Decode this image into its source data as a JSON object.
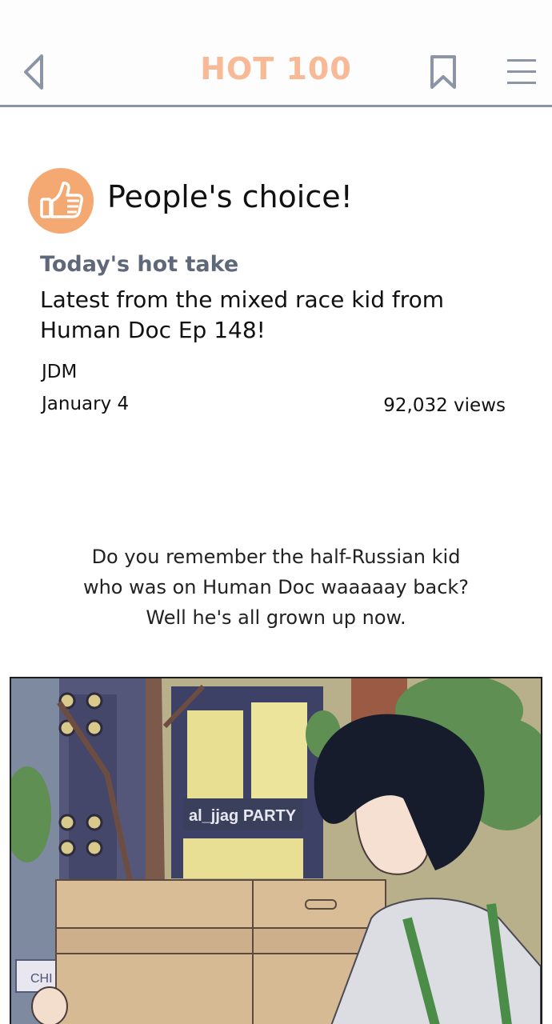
{
  "header": {
    "title": "HOT 100",
    "back_icon": "chevron-left-icon",
    "bookmark_icon": "bookmark-icon",
    "menu_icon": "hamburger-menu-icon",
    "title_color": "#f7b996"
  },
  "badge": {
    "icon": "thumbs-up-icon",
    "text": "People's choice!",
    "color": "#f4a973"
  },
  "article": {
    "subtitle": "Today's hot take",
    "headline_line1": "Latest from the mixed race kid from",
    "headline_line2": "Human Doc Ep 148!",
    "author": "JDM",
    "date": "January 4",
    "views": "92,032 views"
  },
  "caption": {
    "line1": "Do you remember the half-Russian kid",
    "line2": "who was on Human Doc waaaaay back?",
    "line3": "Well he's all grown up now."
  },
  "panel": {
    "sign_text": "al_jjag PARTY",
    "store_sign_text": "CHI"
  }
}
